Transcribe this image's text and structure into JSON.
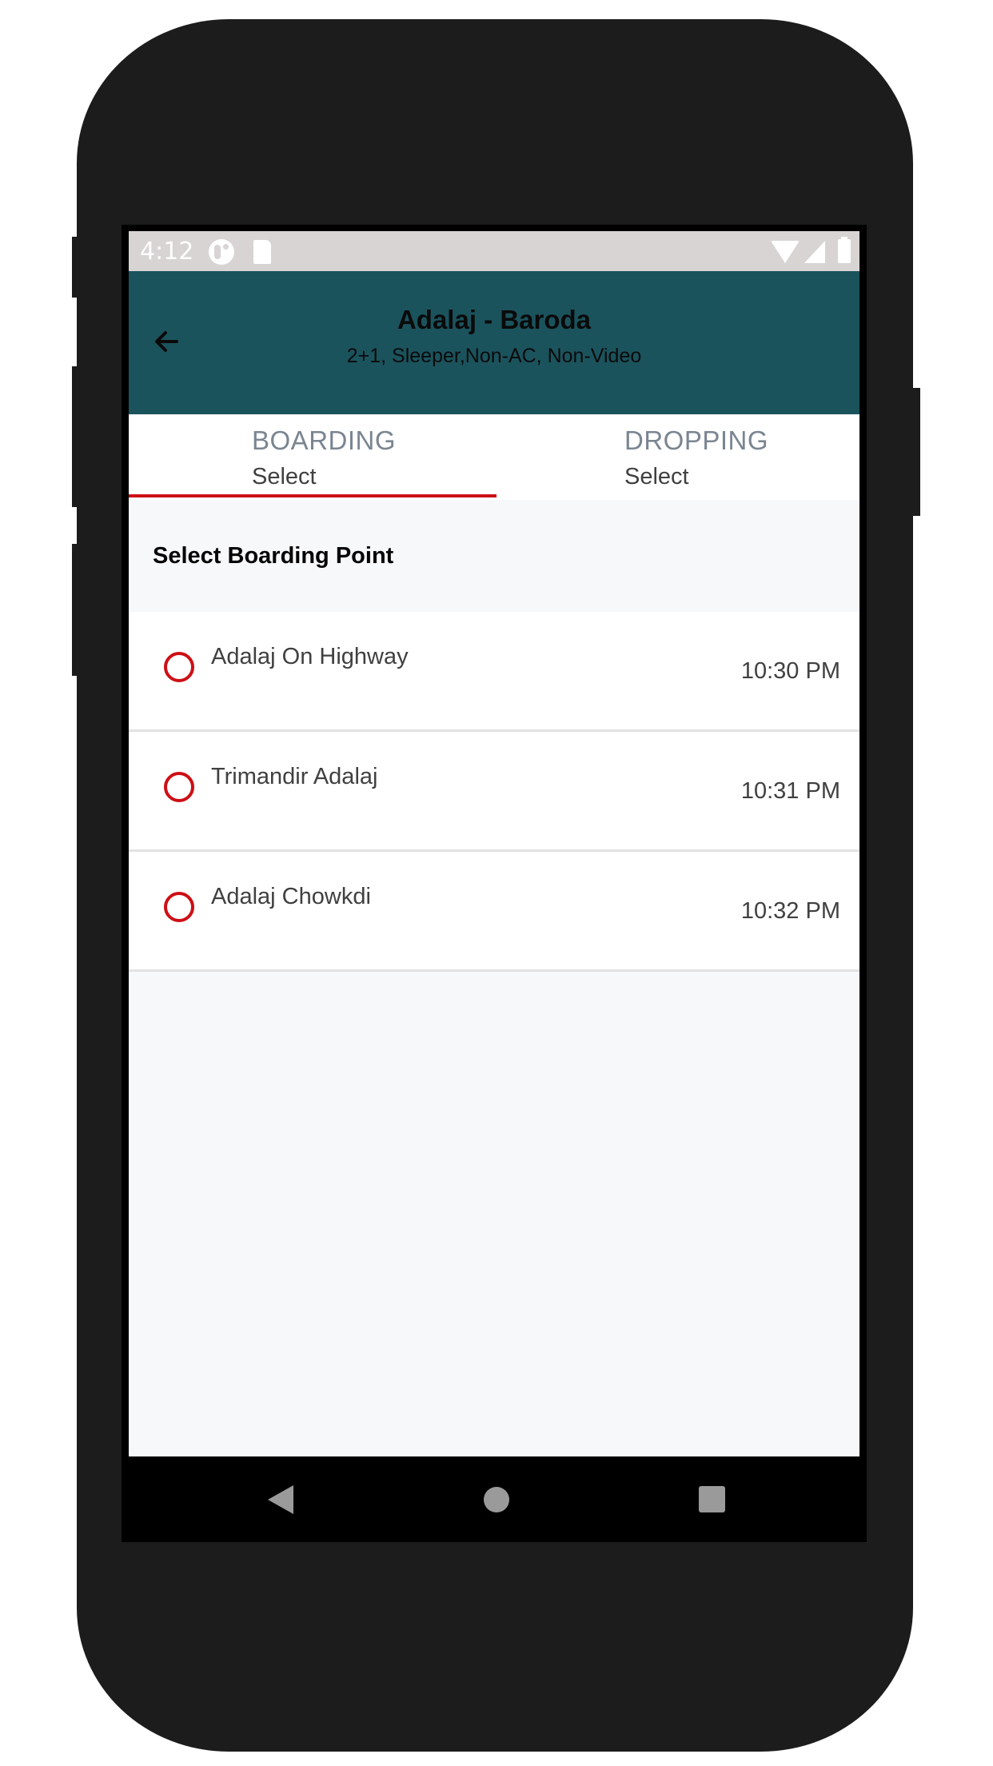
{
  "status_bar": {
    "time": "4:12",
    "icons": [
      "do-not-disturb-icon",
      "sd-card-icon",
      "wifi-icon",
      "signal-icon",
      "battery-icon"
    ]
  },
  "header": {
    "back_icon": "arrow-left-icon",
    "title": "Adalaj - Baroda",
    "subtitle": "2+1, Sleeper,Non-AC, Non-Video",
    "background_color": "#1b535d"
  },
  "tabs": [
    {
      "label": "BOARDING",
      "value": "Select",
      "active": true
    },
    {
      "label": "DROPPING",
      "value": "Select",
      "active": false
    }
  ],
  "accent_color": "#cc1016",
  "section_title": "Select Boarding Point",
  "boarding_points": [
    {
      "name": "Adalaj On Highway",
      "time": "10:30 PM",
      "selected": false
    },
    {
      "name": "Trimandir Adalaj",
      "time": "10:31 PM",
      "selected": false
    },
    {
      "name": "Adalaj Chowkdi",
      "time": "10:32 PM",
      "selected": false
    }
  ],
  "nav_bar": {
    "buttons": [
      "back-triangle-icon",
      "home-circle-icon",
      "recents-square-icon"
    ]
  }
}
